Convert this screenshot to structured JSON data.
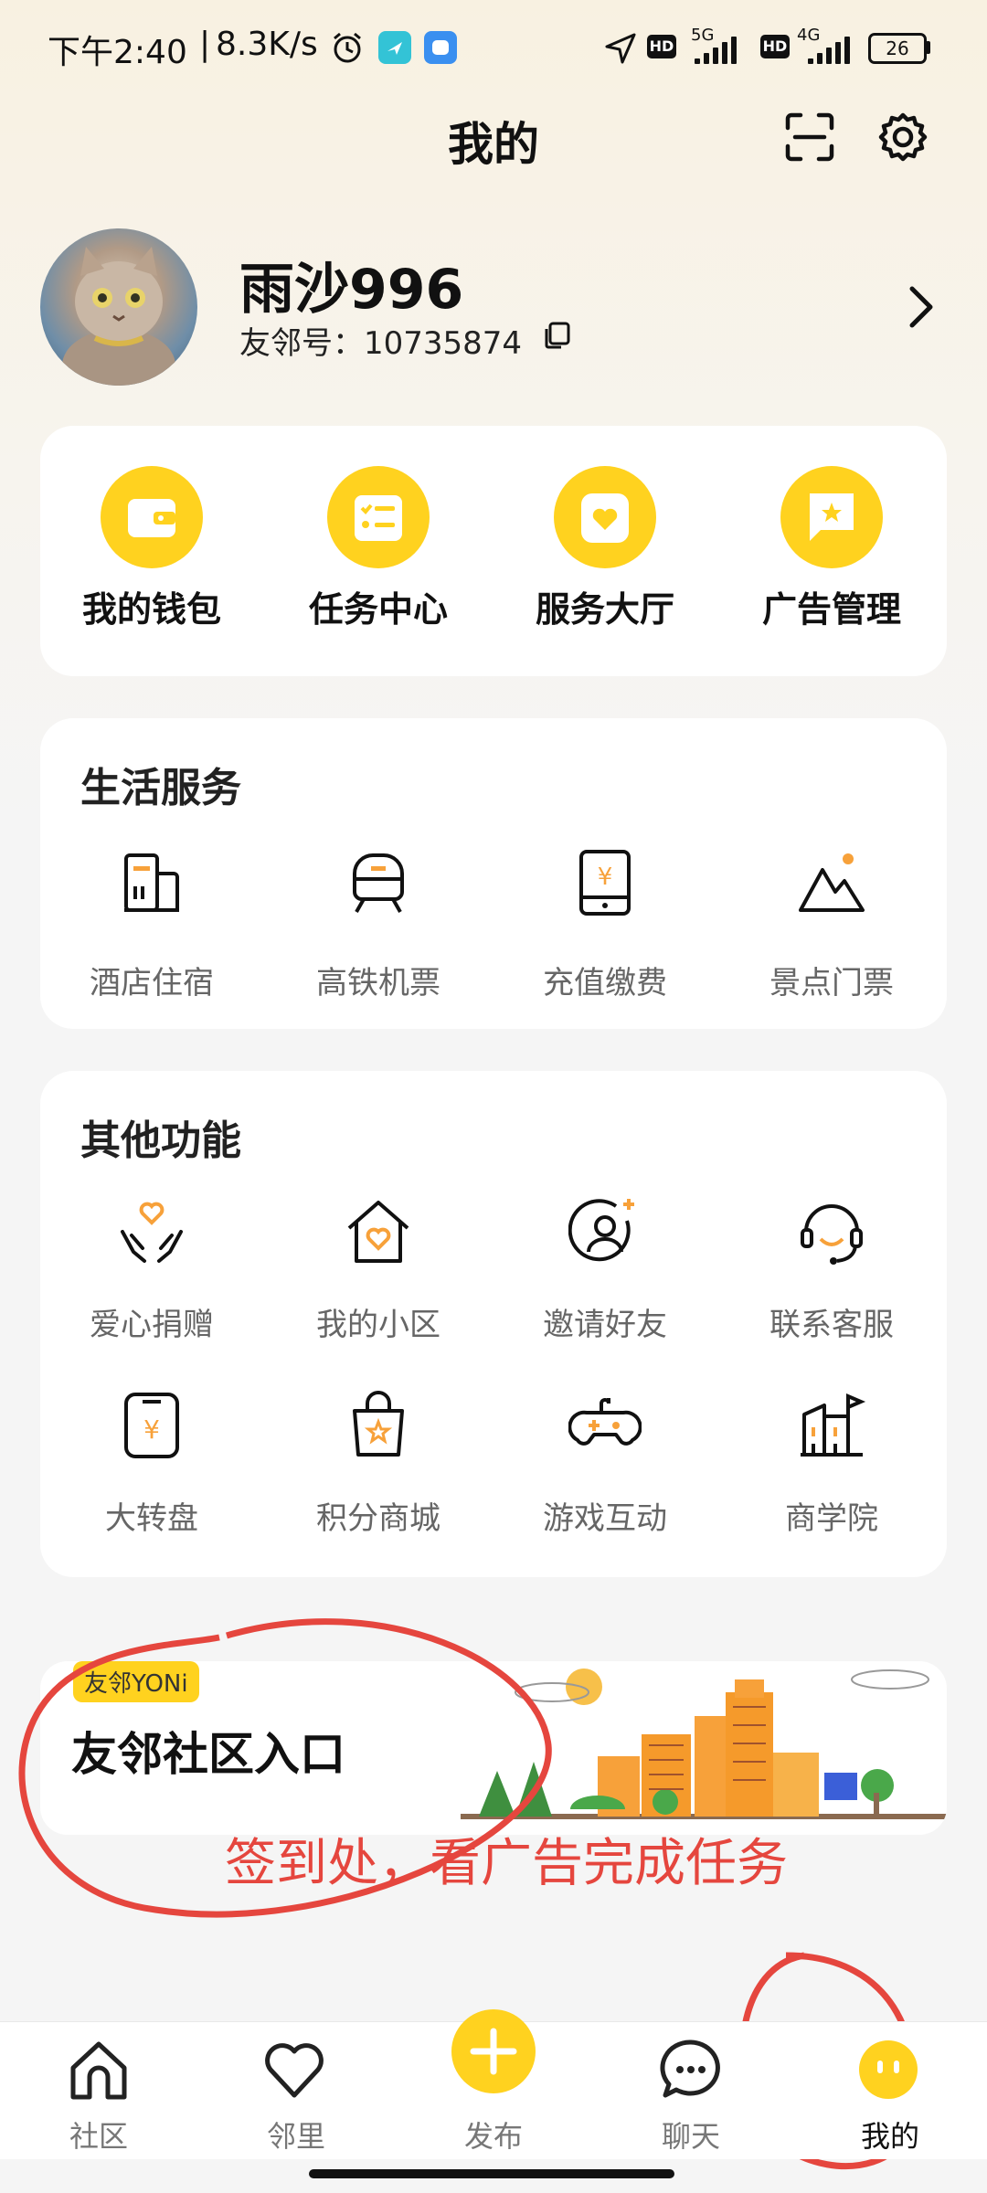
{
  "status_bar": {
    "time": "下午2:40",
    "speed": "8.3K/s",
    "hd1": "HD",
    "net1": "5G",
    "hd2": "HD",
    "net2": "4G",
    "battery": "26"
  },
  "header": {
    "title": "我的",
    "scan_icon": "scan-icon",
    "settings_icon": "gear-icon"
  },
  "profile": {
    "name": "雨沙996",
    "id_label": "友邻号：10735874"
  },
  "quick_actions": [
    {
      "label": "我的钱包",
      "icon": "wallet-icon"
    },
    {
      "label": "任务中心",
      "icon": "task-list-icon"
    },
    {
      "label": "服务大厅",
      "icon": "heart-shield-icon"
    },
    {
      "label": "广告管理",
      "icon": "flag-star-icon"
    }
  ],
  "life_services": {
    "title": "生活服务",
    "items": [
      {
        "label": "酒店住宿",
        "icon": "hotel-icon"
      },
      {
        "label": "高铁机票",
        "icon": "train-icon"
      },
      {
        "label": "充值缴费",
        "icon": "recharge-phone-icon"
      },
      {
        "label": "景点门票",
        "icon": "mountain-icon"
      }
    ]
  },
  "other_features": {
    "title": "其他功能",
    "items": [
      {
        "label": "爱心捐赠",
        "icon": "donate-hands-icon"
      },
      {
        "label": "我的小区",
        "icon": "house-heart-icon"
      },
      {
        "label": "邀请好友",
        "icon": "invite-user-icon"
      },
      {
        "label": "联系客服",
        "icon": "headset-icon"
      },
      {
        "label": "大转盘",
        "icon": "lucky-wheel-icon"
      },
      {
        "label": "积分商城",
        "icon": "shopping-bag-star-icon"
      },
      {
        "label": "游戏互动",
        "icon": "gamepad-icon"
      },
      {
        "label": "商学院",
        "icon": "school-building-icon"
      }
    ]
  },
  "banner": {
    "tag": "友邻YONi",
    "title": "友邻社区入口",
    "annotation": "签到处，看广告完成任务"
  },
  "bottom_nav": [
    {
      "label": "社区",
      "icon": "home-icon"
    },
    {
      "label": "邻里",
      "icon": "heart-icon"
    },
    {
      "label": "发布",
      "icon": "plus-icon"
    },
    {
      "label": "聊天",
      "icon": "chat-bubble-icon"
    },
    {
      "label": "我的",
      "icon": "mascot-face-icon"
    }
  ],
  "colors": {
    "accent": "#FFD21F",
    "orange": "#F7A13A",
    "annotation_red": "#E5463E"
  }
}
